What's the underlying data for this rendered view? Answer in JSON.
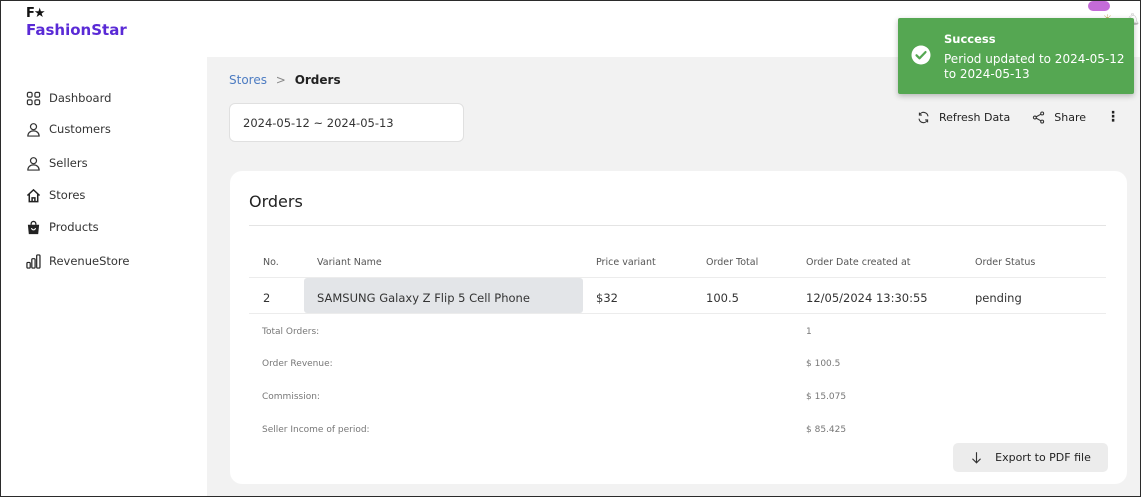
{
  "brand": {
    "mark": "F★",
    "name": "FashionStar"
  },
  "sidebar": {
    "items": [
      {
        "label": "Dashboard",
        "icon": "grid-icon"
      },
      {
        "label": "Customers",
        "icon": "user-icon"
      },
      {
        "label": "Sellers",
        "icon": "user-icon"
      },
      {
        "label": "Stores",
        "icon": "home-icon"
      },
      {
        "label": "Products",
        "icon": "shopping-bag-icon"
      },
      {
        "label": "RevenueStore",
        "icon": "bar-chart-icon"
      }
    ]
  },
  "breadcrumb": {
    "parent": "Stores",
    "separator": ">",
    "current": "Orders"
  },
  "date_range": {
    "value": "2024-05-12 ~ 2024-05-13"
  },
  "actions": {
    "refresh_label": "Refresh Data",
    "share_label": "Share",
    "more_label": "⋮"
  },
  "card": {
    "title": "Orders",
    "columns": [
      "No.",
      "Variant Name",
      "Price variant",
      "Order Total",
      "Order Date created at",
      "Order Status"
    ],
    "rows": [
      {
        "no": "2",
        "variant": "SAMSUNG Galaxy Z Flip 5 Cell Phone",
        "price": "$32",
        "total": "100.5",
        "date": "12/05/2024 13:30:55",
        "status": "pending"
      }
    ],
    "summary": [
      {
        "label": "Total Orders:",
        "value": "1"
      },
      {
        "label": "Order Revenue:",
        "value": "$ 100.5"
      },
      {
        "label": "Commission:",
        "value": "$ 15.075"
      },
      {
        "label": "Seller Income of period:",
        "value": "$ 85.425"
      }
    ],
    "export_label": "Export to PDF file"
  },
  "toast": {
    "title": "Success",
    "message": "Period updated to 2024-05-12 to 2024-05-13",
    "color": "#55a752"
  },
  "colors": {
    "brand": "#5a2ad6",
    "link": "#4d7cc2"
  }
}
